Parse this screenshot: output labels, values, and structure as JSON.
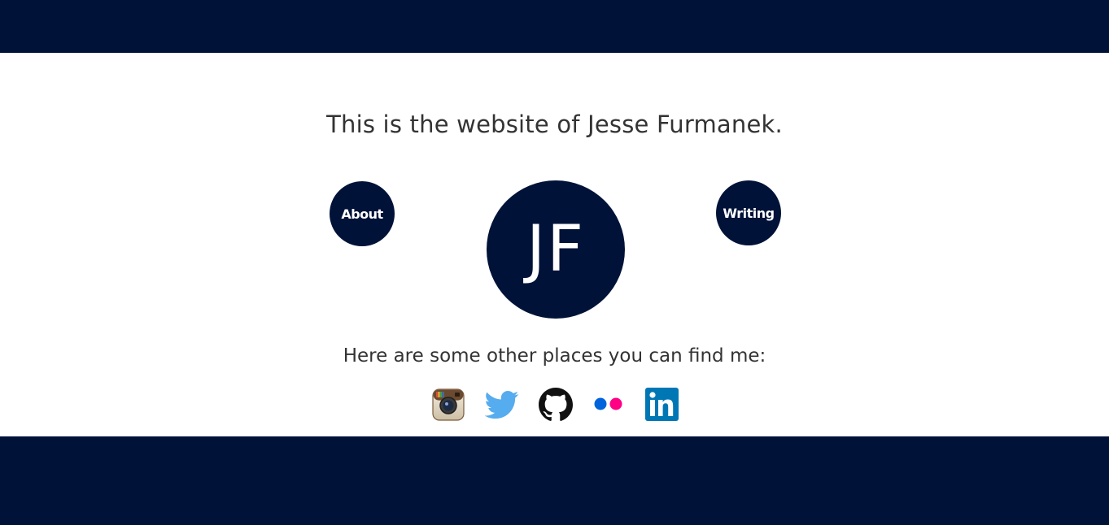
{
  "header": {},
  "headline": "This is the website of Jesse Furmanek.",
  "nav": {
    "about_label": "About",
    "writing_label": "Writing",
    "logo_text": "JF"
  },
  "social": {
    "intro": "Here are some other places you can find me:",
    "items": [
      {
        "name": "instagram",
        "icon": "instagram-icon"
      },
      {
        "name": "twitter",
        "icon": "twitter-icon"
      },
      {
        "name": "github",
        "icon": "github-icon"
      },
      {
        "name": "flickr",
        "icon": "flickr-icon"
      },
      {
        "name": "linkedin",
        "icon": "linkedin-icon"
      }
    ]
  },
  "colors": {
    "brand_navy": "#001238",
    "text": "#333333",
    "twitter_blue": "#55ACEE",
    "flickr_blue": "#0063DC",
    "flickr_pink": "#FF0084",
    "linkedin_blue": "#0077B5"
  }
}
